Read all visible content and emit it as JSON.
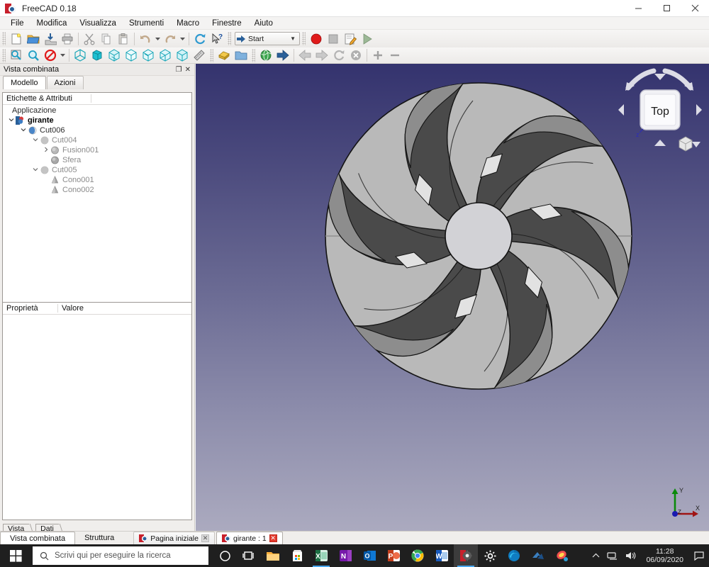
{
  "window": {
    "title": "FreeCAD 0.18",
    "app_icon": "freecad-icon",
    "minimize": "–",
    "maximize": "☐",
    "close": "✕"
  },
  "menubar": {
    "items": [
      {
        "label": "File",
        "name": "menu-file"
      },
      {
        "label": "Modifica",
        "name": "menu-modifica"
      },
      {
        "label": "Visualizza",
        "name": "menu-visualizza"
      },
      {
        "label": "Strumenti",
        "name": "menu-strumenti"
      },
      {
        "label": "Macro",
        "name": "menu-macro"
      },
      {
        "label": "Finestre",
        "name": "menu-finestre"
      },
      {
        "label": "Aiuto",
        "name": "menu-aiuto"
      }
    ]
  },
  "toolbar": {
    "workbench_selected": "Start",
    "file_tools": [
      "new-document-icon",
      "open-document-icon",
      "save-document-icon",
      "print-icon"
    ],
    "edit_tools": [
      "cut-icon",
      "copy-icon",
      "paste-icon"
    ],
    "history_tools": [
      "undo-icon",
      "redo-icon"
    ],
    "refresh_tool": "refresh-icon",
    "whatsthis_tool": "whats-this-icon",
    "macro_tools": [
      "macro-record-icon",
      "macro-stop-icon",
      "macro-edit-icon",
      "macro-execute-icon"
    ],
    "view_tools": [
      "fit-all-icon",
      "fit-selection-icon",
      "draw-style-icon"
    ],
    "std_views": [
      "axonometric-icon",
      "front-view-icon",
      "top-view-icon",
      "right-view-icon",
      "rear-view-icon",
      "bottom-view-icon",
      "left-view-icon"
    ],
    "measure_tool": "measure-icon",
    "part_tools": [
      "workbench-part-icon",
      "boolean-folder-icon"
    ],
    "web_tools": [
      "web-browser-icon",
      "go-forward-icon"
    ],
    "nav_tools": [
      "back-icon",
      "forward-icon",
      "reload-icon",
      "stop-icon"
    ],
    "zoom_tools": [
      "zoom-in-icon",
      "zoom-out-icon"
    ]
  },
  "dock": {
    "title": "Vista combinata",
    "float_button": "❐",
    "close_button": "✕",
    "tabs": [
      {
        "label": "Modello",
        "active": true
      },
      {
        "label": "Azioni",
        "active": false
      }
    ],
    "tree": {
      "header_col1": "Etichette & Attributi",
      "header_col2": "",
      "root": "Applicazione",
      "items": [
        {
          "label": "girante",
          "depth": 0,
          "twist": "v",
          "icon": "document-icon",
          "bold": true,
          "dim": false
        },
        {
          "label": "Cut006",
          "depth": 1,
          "twist": "v",
          "icon": "cut-boolean-icon",
          "bold": false,
          "dim": false
        },
        {
          "label": "Cut004",
          "depth": 2,
          "twist": "v",
          "icon": "cut-boolean-icon-gray",
          "bold": false,
          "dim": true
        },
        {
          "label": "Fusion001",
          "depth": 3,
          "twist": ">",
          "icon": "fusion-icon",
          "bold": false,
          "dim": true
        },
        {
          "label": "Sfera",
          "depth": 3,
          "twist": "",
          "icon": "sphere-icon",
          "bold": false,
          "dim": true
        },
        {
          "label": "Cut005",
          "depth": 2,
          "twist": "v",
          "icon": "cut-boolean-icon-gray",
          "bold": false,
          "dim": true
        },
        {
          "label": "Cono001",
          "depth": 3,
          "twist": "",
          "icon": "cone-icon",
          "bold": false,
          "dim": true
        },
        {
          "label": "Cono002",
          "depth": 3,
          "twist": "",
          "icon": "cone-icon",
          "bold": false,
          "dim": true
        }
      ]
    },
    "properties": {
      "col_property": "Proprietà",
      "col_value": "Valore",
      "rows": []
    },
    "view_data_tabs": [
      {
        "label": "Vista"
      },
      {
        "label": "Dati"
      }
    ]
  },
  "view3d": {
    "nav_cube_face": "Top",
    "nav_cube_axis_label": "z",
    "axis_x": "X",
    "axis_y": "Y",
    "axis_z": "Z",
    "background_top": "#34336e",
    "background_bottom": "#abaabf",
    "model_name": "girante",
    "model_description": "pump impeller, 6 curved blades, top view",
    "blade_count": 6,
    "colors": {
      "body_light": "#b9b9b9",
      "body_mid": "#9a9a9a",
      "blade_dark": "#4a4a4a",
      "hub": "#d2d2d6",
      "highlight": "#e4e4e4",
      "outline": "#1a1a1a"
    }
  },
  "bottom": {
    "panel_tabs": [
      {
        "label": "Vista combinata",
        "active": true
      },
      {
        "label": "Struttura",
        "active": false
      }
    ],
    "document_tabs": [
      {
        "label": "Pagina iniziale",
        "active": false,
        "close": "✕"
      },
      {
        "label": "girante : 1",
        "active": true,
        "close": "✕"
      }
    ]
  },
  "taskbar": {
    "start": "windows-start-icon",
    "search_placeholder": "Scrivi qui per eseguire la ricerca",
    "search_icon": "search-icon",
    "apps": [
      {
        "name": "cortana-icon",
        "glyph": "O"
      },
      {
        "name": "task-view-icon",
        "glyph": "▤"
      },
      {
        "name": "file-explorer-icon",
        "glyph": ""
      },
      {
        "name": "microsoft-store-icon",
        "glyph": ""
      },
      {
        "name": "excel-icon",
        "glyph": "X"
      },
      {
        "name": "onenote-icon",
        "glyph": "N"
      },
      {
        "name": "outlook-icon",
        "glyph": "O"
      },
      {
        "name": "powerpoint-icon",
        "glyph": "P"
      },
      {
        "name": "chrome-icon",
        "glyph": ""
      },
      {
        "name": "word-icon",
        "glyph": "W"
      },
      {
        "name": "freecad-icon",
        "glyph": ""
      },
      {
        "name": "settings-icon",
        "glyph": "✿"
      },
      {
        "name": "edge-icon",
        "glyph": ""
      },
      {
        "name": "bluestacks-icon",
        "glyph": ""
      },
      {
        "name": "paint3d-icon",
        "glyph": ""
      }
    ],
    "tray": {
      "chevron": "⌃",
      "network_icon": "network-icon",
      "volume_icon": "volume-icon",
      "time": "11:28",
      "date": "06/09/2020",
      "action_center": "notifications-icon"
    }
  }
}
